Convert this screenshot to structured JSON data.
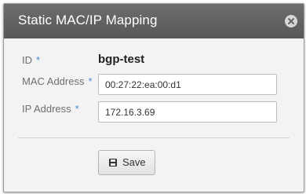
{
  "dialog": {
    "title": "Static MAC/IP Mapping",
    "close_icon": "close-icon"
  },
  "form": {
    "id": {
      "label": "ID",
      "required_mark": "*",
      "value": "bgp-test"
    },
    "mac": {
      "label": "MAC Address",
      "required_mark": "*",
      "value": "00:27:22:ea:00:d1"
    },
    "ip": {
      "label": "IP Address",
      "required_mark": "*",
      "value": "172.16.3.69"
    }
  },
  "actions": {
    "save_label": "Save",
    "save_icon": "floppy-disk-icon"
  },
  "colors": {
    "titlebar": "#5f5f5f",
    "required_asterisk": "#4a8ad0",
    "body_background": "#f3f3f3"
  }
}
